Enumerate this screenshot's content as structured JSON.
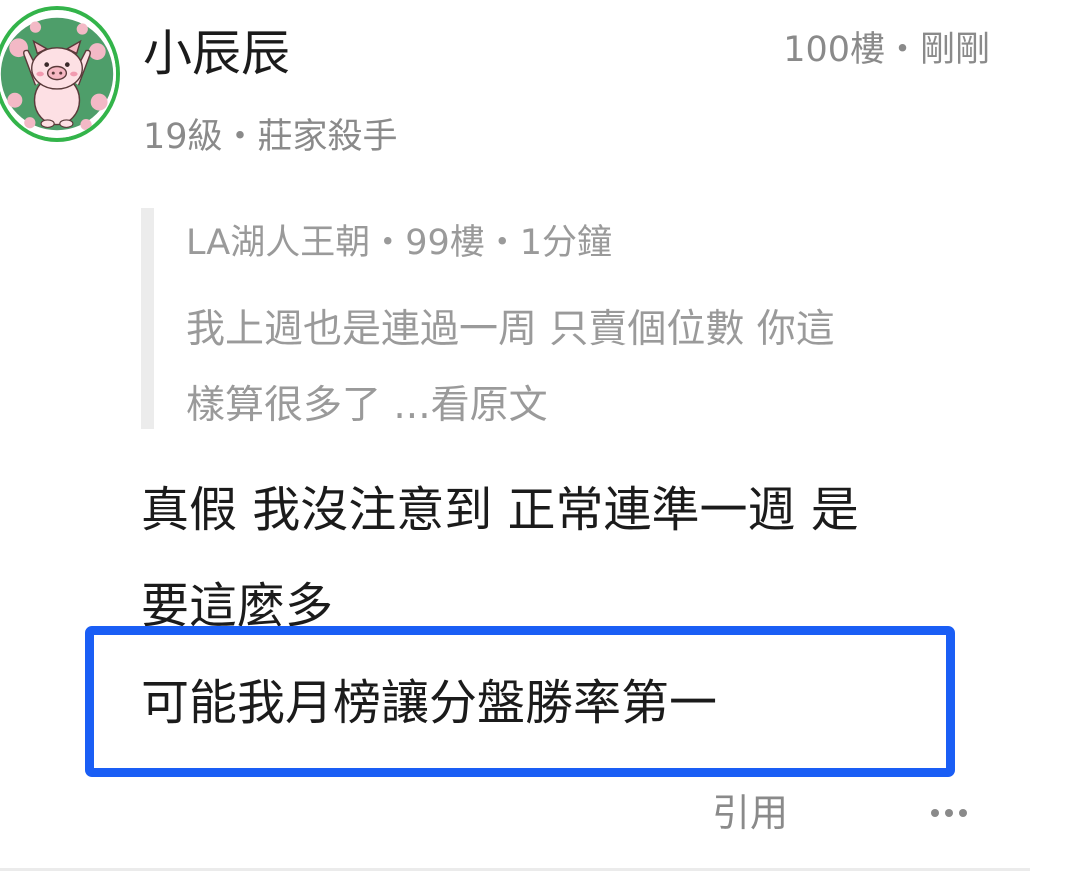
{
  "post": {
    "author": {
      "name": "小辰辰",
      "info": "19級・莊家殺手",
      "avatar_icon": "pig-avatar-icon",
      "avatar_ring_color": "#33b44a"
    },
    "meta": "100樓・剛剛",
    "quote": {
      "header": "LA湖人王朝・99樓・1分鐘",
      "lines": [
        "我上週也是連過一周 只賣個位數 你這",
        "樣算很多了 ...看原文"
      ]
    },
    "body_lines": [
      "真假 我沒注意到 正常連準一週 是",
      "要這麼多"
    ],
    "highlighted_line": "可能我月榜讓分盤勝率第一",
    "highlight_color": "#1a5ef5",
    "actions": {
      "quote_label": "引用",
      "more_icon": "more-horizontal-icon"
    }
  }
}
